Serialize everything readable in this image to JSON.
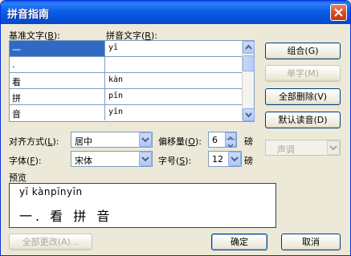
{
  "window": {
    "title": "拼音指南"
  },
  "labels": {
    "base_text": "基准文字(",
    "base_text_key": "B",
    "base_text_end": "):",
    "pinyin_text": "拼音文字(",
    "pinyin_text_key": "R",
    "pinyin_text_end": "):",
    "alignment": "对齐方式(",
    "alignment_key": "L",
    "alignment_end": "):",
    "offset": "偏移量(",
    "offset_key": "O",
    "offset_end": "):",
    "offset_unit": "磅",
    "font": "字体(",
    "font_key": "F",
    "font_end": "):",
    "font_size": "字号(",
    "font_size_key": "S",
    "font_size_end": "):",
    "font_size_unit": "磅",
    "preview": "预览"
  },
  "grid": {
    "rows": [
      {
        "base": "一",
        "pinyin": "yī",
        "selected": true
      },
      {
        "base": ".",
        "pinyin": ""
      },
      {
        "base": "看",
        "pinyin": "kàn"
      },
      {
        "base": "拼",
        "pinyin": "pīn"
      },
      {
        "base": "音",
        "pinyin": "yīn"
      }
    ]
  },
  "buttons": {
    "group": "组合(G)",
    "single_char": "单字(M)",
    "delete_all": "全部删除(V)",
    "default_reading": "默认读音(D)",
    "tone": "声调",
    "change_all": "全部更改(A)...",
    "ok": "确定",
    "cancel": "取消"
  },
  "fields": {
    "alignment": "居中",
    "offset": "6",
    "font": "宋体",
    "font_size": "12"
  },
  "preview": {
    "pinyin": "yī  kànpīnyīn",
    "text": "一. 看 拼 音"
  },
  "colors": {
    "titlebar": "#0a5fea",
    "selection": "#316ac5",
    "face": "#ece9d8"
  }
}
